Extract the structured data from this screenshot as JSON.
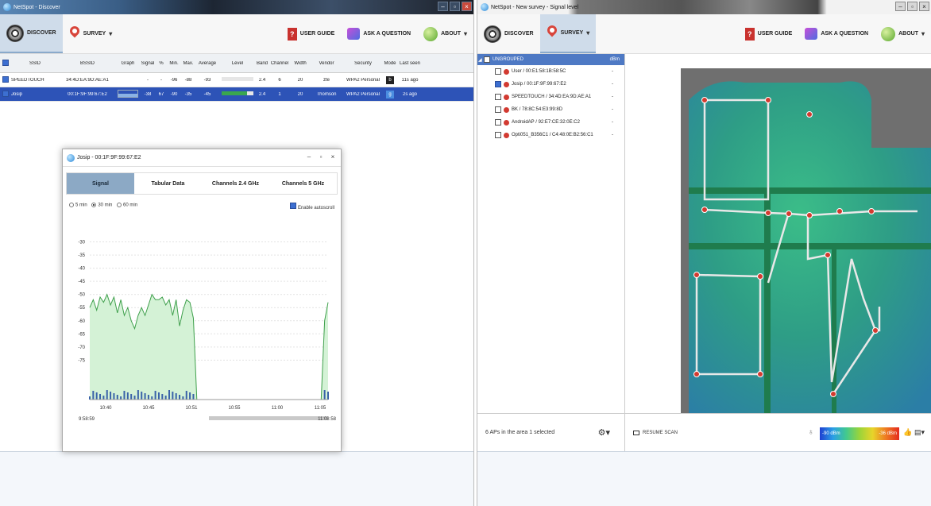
{
  "left": {
    "title": "NetSpot - Discover",
    "toolbar": {
      "discover": "DISCOVER",
      "survey": "SURVEY",
      "user_guide": "USER GUIDE",
      "ask": "ASK A QUESTION",
      "about": "ABOUT"
    },
    "columns": [
      "SSID",
      "BSSID",
      "Graph",
      "Signal",
      "%",
      "Min.",
      "Max.",
      "Average",
      "Level",
      "Band",
      "Channel",
      "Width",
      "Vendor",
      "Security",
      "Mode",
      "Last seen"
    ],
    "rows": [
      {
        "ssid": "SPEEDTOUCH",
        "bssid": "34:4D:EA:9D:AE:A1",
        "signal": "-",
        "pct": "-",
        "min": "-96",
        "max": "-88",
        "avg": "-93",
        "band": "2.4",
        "channel": "6",
        "width": "20",
        "vendor": "zte",
        "security": "WPA2 Personal",
        "last": "11s ago"
      },
      {
        "ssid": "Josip",
        "bssid": "00:1F:9F:99:67:E2",
        "signal": "-38",
        "pct": "67",
        "min": "-90",
        "max": "-35",
        "avg": "-45",
        "band": "2.4",
        "channel": "1",
        "width": "20",
        "vendor": "Thomson",
        "security": "WPA2 Personal",
        "last": "2s ago"
      }
    ],
    "popup": {
      "title": "Josip - 00:1F:9F:99:67:E2",
      "tabs": [
        "Signal",
        "Tabular Data",
        "Channels 2.4 GHz",
        "Channels 5 GHz"
      ],
      "range_options": [
        "5 min",
        "30 min",
        "60 min"
      ],
      "autoscroll": "Enable autoscroll",
      "start_time": "9:58:59",
      "end_time": "11:08:58"
    }
  },
  "right": {
    "title": "NetSpot - New survey - Signal level",
    "toolbar": {
      "discover": "DISCOVER",
      "survey": "SURVEY",
      "user_guide": "USER GUIDE",
      "ask": "ASK A QUESTION",
      "about": "ABOUT"
    },
    "group": {
      "name": "UNGROUPED",
      "unit": "dBm"
    },
    "aps": [
      {
        "name": "User / 00:E1:58:1B:58:5C",
        "checked": false,
        "value": "-"
      },
      {
        "name": "Josip / 00:1F:9F:99:67:E2",
        "checked": true,
        "value": "-"
      },
      {
        "name": "SPEEDTOUCH / 34:4D:EA:9D:AE:A1",
        "checked": false,
        "value": "-"
      },
      {
        "name": "BK / 78:8C:54:E3:99:8D",
        "checked": false,
        "value": "-"
      },
      {
        "name": "AndroidAP / 92:E7:CE:32:0E:C2",
        "checked": false,
        "value": "-"
      },
      {
        "name": "Opti051_B356C1 / C4:48:0E:B2:56:C1",
        "checked": false,
        "value": "-"
      }
    ],
    "footer_status": "6 APs in the area 1 selected",
    "resume_scan": "RESUME SCAN",
    "legend_min": "-90 dBm",
    "legend_max": "-36 dBm"
  },
  "chart_data": {
    "type": "area",
    "series": [
      {
        "name": "Josip",
        "values": [
          -55,
          -52,
          -56,
          -51,
          -53,
          -50,
          -54,
          -51,
          -57,
          -52,
          -58,
          -55,
          -60,
          -63,
          -58,
          -55,
          -58,
          -54,
          -50,
          -52,
          -52,
          -51,
          -54,
          -52,
          -58,
          -52,
          -62,
          -56,
          -52,
          -53,
          -59,
          -90,
          -90,
          -90,
          -90,
          -90,
          -90,
          -90,
          -90,
          -90,
          -90,
          -90,
          -90,
          -90,
          -90,
          -90,
          -90,
          -90,
          -90,
          -90,
          -90,
          -90,
          -90,
          -90,
          -90,
          -90,
          -90,
          -90,
          -90,
          -90,
          -90,
          -90,
          -90,
          -90,
          -90,
          -90,
          -90,
          -90,
          -60,
          -53
        ]
      }
    ],
    "x_ticks": [
      "10:40",
      "10:45",
      "10:51",
      "10:55",
      "11:00",
      "11:05"
    ],
    "y_ticks": [
      "-30",
      "-35",
      "-40",
      "-45",
      "-50",
      "-55",
      "-60",
      "-65",
      "-70",
      "-75"
    ],
    "ylim": [
      -90,
      -25
    ],
    "colors": {
      "fill": "#d4f2d6",
      "line": "#3fa04c",
      "bars": "#3a63a8"
    }
  }
}
